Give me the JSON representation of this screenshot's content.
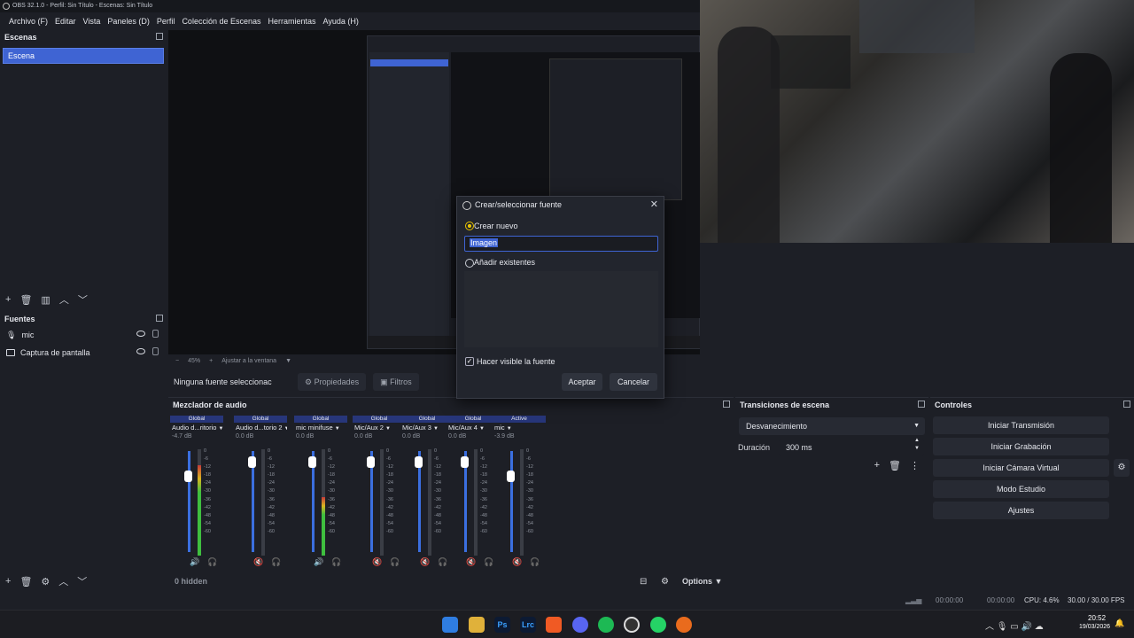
{
  "window": {
    "title": "OBS 32.1.0 - Perfil: Sin Título - Escenas: Sin Título"
  },
  "menu": [
    "Archivo (F)",
    "Editar",
    "Vista",
    "Paneles (D)",
    "Perfil",
    "Colección de Escenas",
    "Herramientas",
    "Ayuda (H)"
  ],
  "scenes": {
    "title": "Escenas",
    "items": [
      "Escena"
    ]
  },
  "sources": {
    "title": "Fuentes",
    "items": [
      {
        "label": "mic",
        "icon": "mic-icon"
      },
      {
        "label": "Captura de pantalla",
        "icon": "monitor-icon"
      }
    ]
  },
  "preview": {
    "zoom": "45%",
    "fit": "Ajustar a la ventana"
  },
  "context": {
    "none_selected": "Ninguna fuente seleccionac",
    "properties": "Propiedades",
    "filters": "Filtros"
  },
  "dialog": {
    "title": "Crear/seleccionar fuente",
    "create_new": "Crear nuevo",
    "name_value": "Imagen",
    "add_existing": "Añadir existentes",
    "make_visible": "Hacer visible la fuente",
    "accept": "Aceptar",
    "cancel": "Cancelar"
  },
  "mixer": {
    "title": "Mezclador de audio",
    "hidden": "0 hidden",
    "options": "Options",
    "scale": [
      "0",
      "-6",
      "-12",
      "-18",
      "-24",
      "-30",
      "-36",
      "-42",
      "-48",
      "-54",
      "-60"
    ],
    "channels": [
      {
        "scope": "Global",
        "name": "Audio d...ritorio",
        "db": "-4.7 dB",
        "level": 0.85,
        "muted": false
      },
      {
        "scope": "Global",
        "name": "Audio d...torio 2",
        "db": "0.0 dB",
        "level": 0.0,
        "muted": true
      },
      {
        "scope": "Global",
        "name": "mic minifuse",
        "db": "0.0 dB",
        "level": 0.55,
        "muted": false
      },
      {
        "scope": "Global",
        "name": "Mic/Aux 2",
        "db": "0.0 dB",
        "level": 0.0,
        "muted": true
      },
      {
        "scope": "Global",
        "name": "Mic/Aux 3",
        "db": "0.0 dB",
        "level": 0.0,
        "muted": true
      },
      {
        "scope": "Global",
        "name": "Mic/Aux 4",
        "db": "0.0 dB",
        "level": 0.0,
        "muted": true
      },
      {
        "scope": "Active",
        "name": "mic",
        "db": "-3.9 dB",
        "level": 0.0,
        "muted": true
      }
    ]
  },
  "transitions": {
    "title": "Transiciones de escena",
    "type": "Desvanecimiento",
    "duration_label": "Duración",
    "duration": "300 ms"
  },
  "controls": {
    "title": "Controles",
    "buttons": [
      "Iniciar Transmisión",
      "Iniciar Grabación",
      "Iniciar Cámara Virtual",
      "Modo Estudio",
      "Ajustes"
    ]
  },
  "statusbar": {
    "rec_time": "00:00:00",
    "stream_time": "00:00:00",
    "cpu": "CPU: 4.6%",
    "fps": "30.00 / 30.00 FPS"
  },
  "taskbar": {
    "time": "20:52",
    "date": "19/03/2026"
  },
  "colors": {
    "accent": "#3f64d3",
    "meter_green": "#3fbf3f",
    "meter_red": "#c63a3a"
  }
}
